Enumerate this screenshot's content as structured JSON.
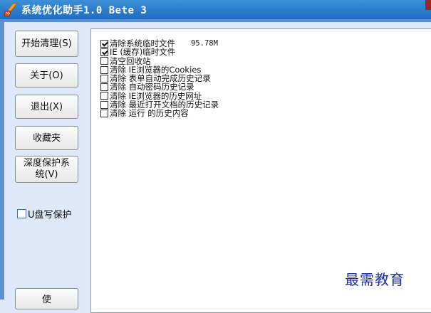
{
  "window": {
    "title": "系统优化助手1.0 Bete 3"
  },
  "sidebar": {
    "buttons": [
      {
        "label": "开始清理(S)"
      },
      {
        "label": "关于(O)"
      },
      {
        "label": "退出(X)"
      },
      {
        "label": "收藏夹"
      },
      {
        "label_line1": "深度保护系",
        "label_line2": "统(V)"
      },
      {
        "label": "使"
      }
    ],
    "usb_protect": {
      "label": "U盘写保护",
      "checked": false
    }
  },
  "clean_items": [
    {
      "label": "清除系统临时文件",
      "size": "95.78M",
      "checked": true
    },
    {
      "label": "IE (缓存)临时文件",
      "checked": true
    },
    {
      "label": "清空回收站",
      "checked": false
    },
    {
      "label": "清除 IE浏览器的Cookies",
      "checked": false
    },
    {
      "label": "清除 表单自动完成历史记录",
      "checked": false
    },
    {
      "label": "清除 自动密码历史记录",
      "checked": false
    },
    {
      "label": "清除 IE浏览器的历史网址",
      "checked": false
    },
    {
      "label": "清除 最近打开文档的历史记录",
      "checked": false
    },
    {
      "label": "清除 运行 的历史内容",
      "checked": false
    }
  ],
  "watermark": {
    "text": "最需教育"
  },
  "colors": {
    "titlebar": "#1f6dc2",
    "background": "#dde9f9",
    "panel": "#ffffff",
    "watermark": "#1c2fa8"
  },
  "icons": {
    "app": "broom-icon"
  }
}
